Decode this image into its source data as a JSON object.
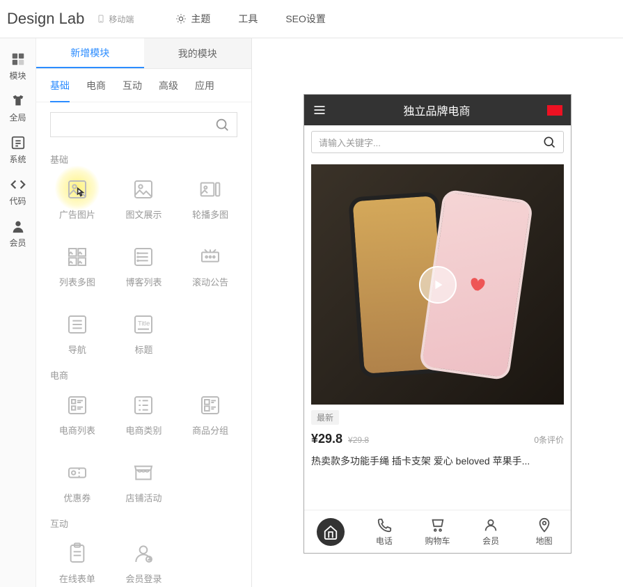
{
  "app_title": "Design Lab",
  "mobile_tag": "移动端",
  "topnav": [
    {
      "label": "主题"
    },
    {
      "label": "工具"
    },
    {
      "label": "SEO设置"
    }
  ],
  "rail": [
    {
      "label": "模块"
    },
    {
      "label": "全局"
    },
    {
      "label": "系统"
    },
    {
      "label": "代码"
    },
    {
      "label": "会员"
    }
  ],
  "panel_tabs": [
    {
      "label": "新增模块",
      "active": true
    },
    {
      "label": "我的模块",
      "active": false
    }
  ],
  "category_tabs": [
    {
      "label": "基础",
      "active": true
    },
    {
      "label": "电商"
    },
    {
      "label": "互动"
    },
    {
      "label": "高级"
    },
    {
      "label": "应用"
    }
  ],
  "search_placeholder": "",
  "sections": {
    "basic": {
      "title": "基础",
      "items": [
        "广告图片",
        "图文展示",
        "轮播多图",
        "列表多图",
        "博客列表",
        "滚动公告",
        "导航",
        "标题"
      ]
    },
    "ecom": {
      "title": "电商",
      "items": [
        "电商列表",
        "电商类别",
        "商品分组",
        "优惠券",
        "店铺活动"
      ]
    },
    "interact": {
      "title": "互动",
      "items": [
        "在线表单",
        "会员登录"
      ]
    }
  },
  "preview": {
    "site_title": "独立品牌电商",
    "search_placeholder": "请输入关键字...",
    "badge": "最新",
    "price": "¥29.8",
    "price_old": "¥29.8",
    "reviews": "0条评价",
    "product_title": "热卖款多功能手绳 插卡支架 爱心 beloved 苹果手...",
    "tabbar": [
      "电话",
      "购物车",
      "会员",
      "地图"
    ]
  }
}
